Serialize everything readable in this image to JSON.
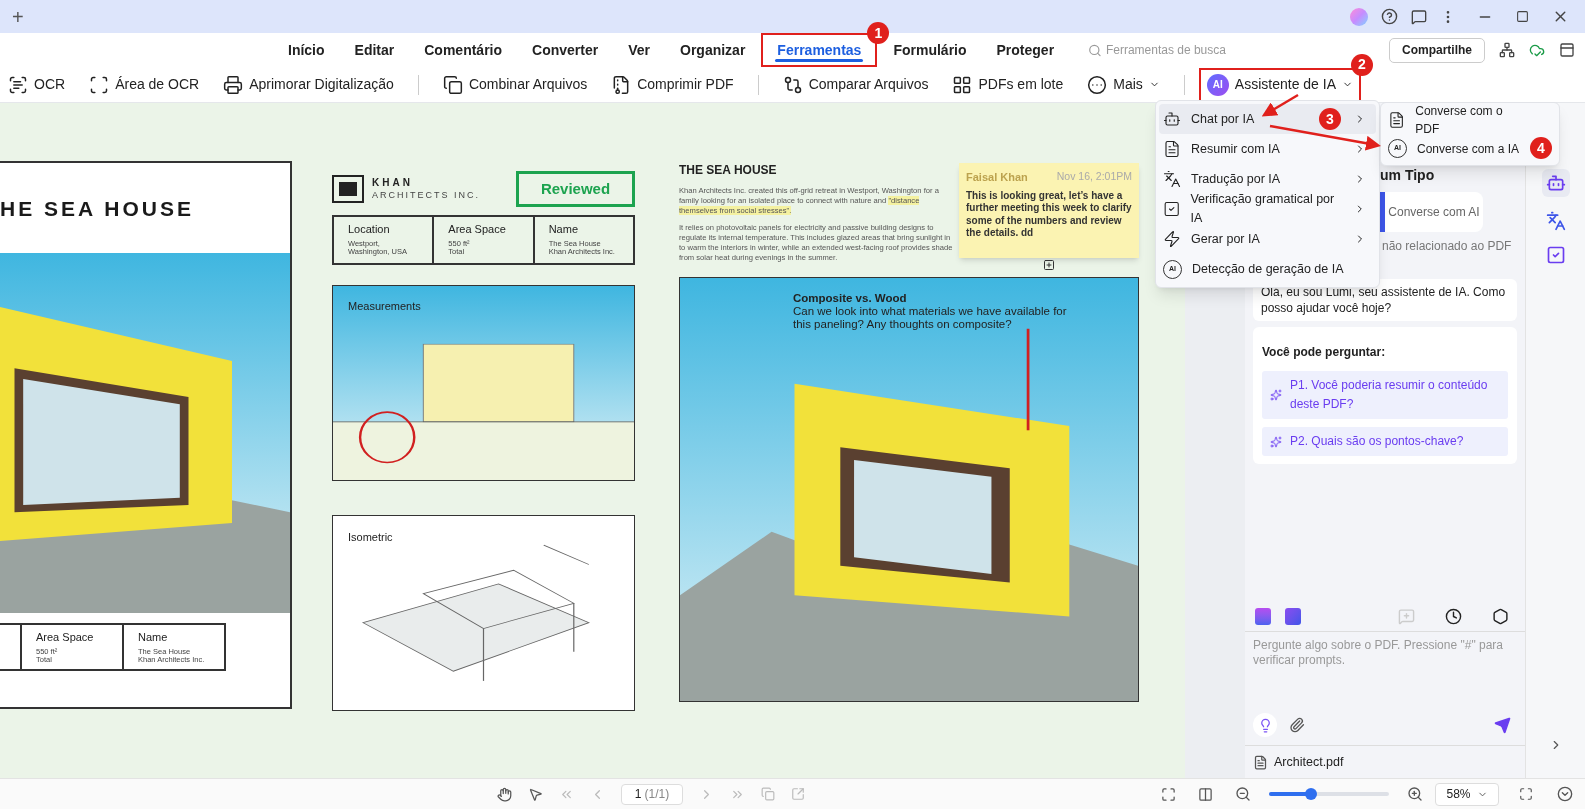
{
  "window": {
    "new_tab": "+"
  },
  "menu_tabs": [
    {
      "label": "Início",
      "selected": false
    },
    {
      "label": "Editar",
      "selected": false
    },
    {
      "label": "Comentário",
      "selected": false
    },
    {
      "label": "Converter",
      "selected": false
    },
    {
      "label": "Ver",
      "selected": false
    },
    {
      "label": "Organizar",
      "selected": false
    },
    {
      "label": "Ferramentas",
      "selected": true,
      "callout": "1"
    },
    {
      "label": "Formulário",
      "selected": false
    },
    {
      "label": "Proteger",
      "selected": false
    }
  ],
  "search": {
    "placeholder": "Ferramentas de busca"
  },
  "share_button": "Compartilhe",
  "toolbar": [
    {
      "kind": "tool",
      "label": "OCR",
      "dropdown": false
    },
    {
      "kind": "tool",
      "label": "Área de OCR",
      "dropdown": false
    },
    {
      "kind": "tool",
      "label": "Aprimorar Digitalização",
      "dropdown": false
    },
    {
      "kind": "divider"
    },
    {
      "kind": "tool",
      "label": "Combinar Arquivos",
      "dropdown": false
    },
    {
      "kind": "tool",
      "label": "Comprimir PDF",
      "dropdown": false
    },
    {
      "kind": "divider"
    },
    {
      "kind": "tool",
      "label": "Comparar Arquivos",
      "dropdown": false
    },
    {
      "kind": "tool",
      "label": "PDFs em lote",
      "dropdown": false
    },
    {
      "kind": "tool",
      "label": "Mais",
      "dropdown": true
    },
    {
      "kind": "divider"
    },
    {
      "kind": "tool",
      "badge": "AI",
      "label": "Assistente de IA",
      "dropdown": true,
      "callout": "2"
    }
  ],
  "ai_menu": {
    "items": [
      {
        "label": "Chat por IA",
        "submenu": true,
        "selected": true,
        "callout": "3"
      },
      {
        "label": "Resumir com IA",
        "submenu": true,
        "selected": false
      },
      {
        "label": "Tradução por IA",
        "submenu": true,
        "selected": false
      },
      {
        "label": "Verificação gramatical por IA",
        "submenu": true,
        "selected": false
      },
      {
        "label": "Gerar por IA",
        "submenu": true,
        "selected": false
      },
      {
        "icon_text": "AI",
        "label": "Detecção de geração de IA",
        "submenu": false,
        "selected": false
      }
    ]
  },
  "submenu": {
    "items": [
      {
        "label": "Converse com o PDF"
      },
      {
        "icon_text": "AI",
        "label": "Converse com a IA",
        "callout": "4"
      }
    ]
  },
  "document": {
    "left_title": "HE SEA HOUSE",
    "left_table": [
      {
        "label": "Area Space",
        "lines": [
          "550 ft²",
          "Total"
        ]
      },
      {
        "label": "Name",
        "lines": [
          "The Sea House",
          "Khan Architects Inc."
        ]
      }
    ],
    "logo": {
      "name": "KHAN",
      "sub": "ARCHITECTS INC."
    },
    "stamp": "Reviewed",
    "info_table": [
      {
        "label": "Location",
        "lines": [
          "Westport,",
          "Washington, USA"
        ]
      },
      {
        "label": "Area Space",
        "lines": [
          "550 ft²",
          "Total"
        ]
      },
      {
        "label": "Name",
        "lines": [
          "The Sea House",
          "Khan Architects Inc."
        ]
      }
    ],
    "measurements_caption": "Measurements",
    "isometric_caption": "Isometric",
    "heading": "THE SEA HOUSE",
    "paragraphs": [
      {
        "text": "Khan Architects Inc. created this off-grid retreat in Westport, Washington for a family looking for an isolated place to connect with nature and",
        "highlight": "\"distance themselves from social stresses\"."
      },
      {
        "text": "It relies on photovoltaic panels for electricity and passive building designs to regulate its internal temperature. This includes glazed areas that bring sunlight in to warm the interiors in winter, while an extended west-facing roof provides shade from solar heat during evenings in the summer."
      }
    ],
    "sticky_note": {
      "author": "Faisal Khan",
      "time": "Nov 16, 2:01PM",
      "text": "This is looking great, let’s have a further meeting this week to clarify some of the numbers and review the details. dd"
    },
    "comment": {
      "title": "Composite vs. Wood",
      "text": "Can we look into what materials we have available for this paneling? Any thoughts on composite?"
    }
  },
  "chat": {
    "title": "um Tipo",
    "mode_button": "Converse com AI",
    "mode_note": "não relacionado ao PDF",
    "greeting": "Olá, eu sou Lumi, seu assistente de IA. Como posso ajudar você hoje?",
    "suggest_title": "Você pode perguntar:",
    "suggestions": [
      "P1. Você poderia resumir o conteúdo deste PDF?",
      "P2. Quais são os pontos-chave?"
    ],
    "input": {
      "placeholder": "Pergunte algo sobre o PDF. Pressione \"#\" para verificar prompts."
    },
    "file": "Architect.pdf"
  },
  "status_bar": {
    "page": "1",
    "page_total": "(1/1)",
    "zoom": {
      "level": 0.35,
      "value": "58%"
    }
  }
}
